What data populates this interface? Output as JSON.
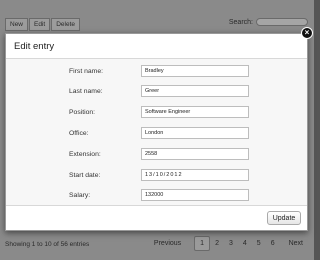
{
  "toolbar": {
    "new_label": "New",
    "edit_label": "Edit",
    "delete_label": "Delete",
    "search_label": "Search:"
  },
  "table_info": "Showing 1 to 10 of 56 entries",
  "pager": {
    "previous": "Previous",
    "pages": [
      "1",
      "2",
      "3",
      "4",
      "5",
      "6"
    ],
    "current": "1",
    "next": "Next"
  },
  "modal": {
    "title": "Edit entry",
    "fields": [
      {
        "label": "First name:",
        "value": "Bradley"
      },
      {
        "label": "Last name:",
        "value": "Greer"
      },
      {
        "label": "Position:",
        "value": "Software Engineer"
      },
      {
        "label": "Office:",
        "value": "London"
      },
      {
        "label": "Extension:",
        "value": "2558"
      },
      {
        "label": "Start date:",
        "value": "13/10/2012"
      },
      {
        "label": "Salary:",
        "value": "132000"
      }
    ],
    "update_label": "Update",
    "close_icon": "close-icon"
  }
}
